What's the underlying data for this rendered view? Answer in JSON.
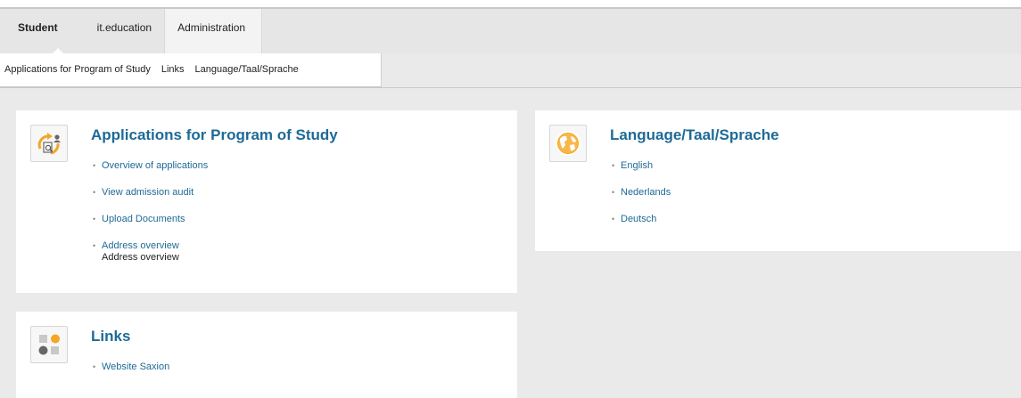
{
  "tabs": [
    {
      "label": "Student",
      "active": true
    },
    {
      "label": "it.education",
      "active": false
    },
    {
      "label": "Administration",
      "active": false
    }
  ],
  "subnav": [
    {
      "label": "Applications for Program of Study"
    },
    {
      "label": "Links"
    },
    {
      "label": "Language/Taal/Sprache"
    }
  ],
  "cards": {
    "applications": {
      "title": "Applications for Program of Study",
      "icon": "applications-icon",
      "links": [
        {
          "label": "Overview of applications"
        },
        {
          "label": "View admission audit"
        },
        {
          "label": "Upload Documents"
        },
        {
          "label": "Address overview",
          "sub": "Address overview"
        }
      ]
    },
    "language": {
      "title": "Language/Taal/Sprache",
      "icon": "globe-icon",
      "links": [
        {
          "label": "English"
        },
        {
          "label": "Nederlands"
        },
        {
          "label": "Deutsch"
        }
      ]
    },
    "links": {
      "title": "Links",
      "icon": "links-icon",
      "links": [
        {
          "label": "Website Saxion"
        }
      ]
    }
  },
  "colors": {
    "link": "#1e6a96",
    "accent": "#f5a623",
    "background": "#eaeaea"
  }
}
